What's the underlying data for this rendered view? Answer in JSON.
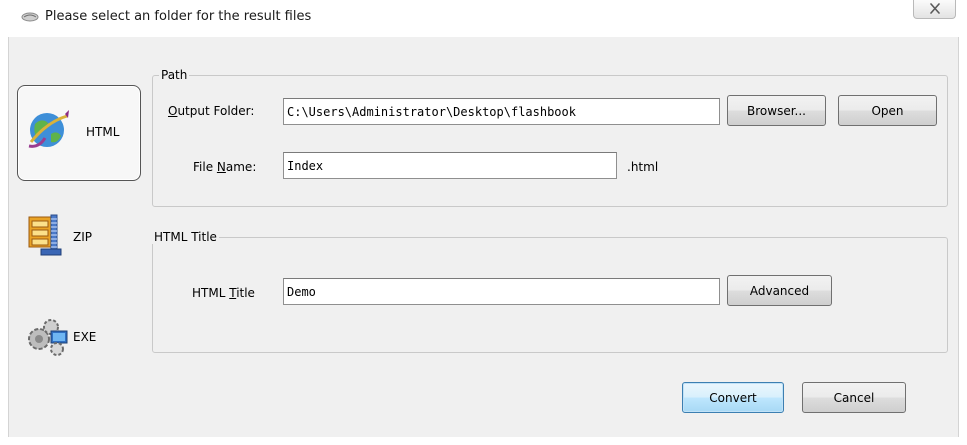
{
  "window": {
    "title": "Please select an folder for the result files",
    "close_icon": "close-icon"
  },
  "nav": {
    "items": [
      {
        "label": "HTML",
        "icon": "globe-icon",
        "active": true
      },
      {
        "label": "ZIP",
        "icon": "zip-archive-icon",
        "active": false
      },
      {
        "label": "EXE",
        "icon": "exe-gears-icon",
        "active": false
      }
    ]
  },
  "path_group": {
    "legend": "Path",
    "output_folder": {
      "label_prefix": "",
      "label_mnemonic": "O",
      "label_suffix": "utput Folder:",
      "value": "C:\\Users\\Administrator\\Desktop\\flashbook"
    },
    "file_name": {
      "label_prefix": "File ",
      "label_mnemonic": "N",
      "label_suffix": "ame:",
      "value": "Index",
      "extension": ".html"
    },
    "browser_label": "Browser...",
    "open_label": "Open"
  },
  "title_group": {
    "legend": "HTML Title",
    "html_title": {
      "label_prefix": "HTML ",
      "label_mnemonic": "T",
      "label_suffix": "itle",
      "value": "Demo"
    },
    "advanced_label": "Advanced"
  },
  "footer": {
    "convert_label": "Convert",
    "cancel_label": "Cancel"
  },
  "colors": {
    "default_button_border": "#3c7fb1",
    "dialog_background": "#f0f0f0"
  }
}
